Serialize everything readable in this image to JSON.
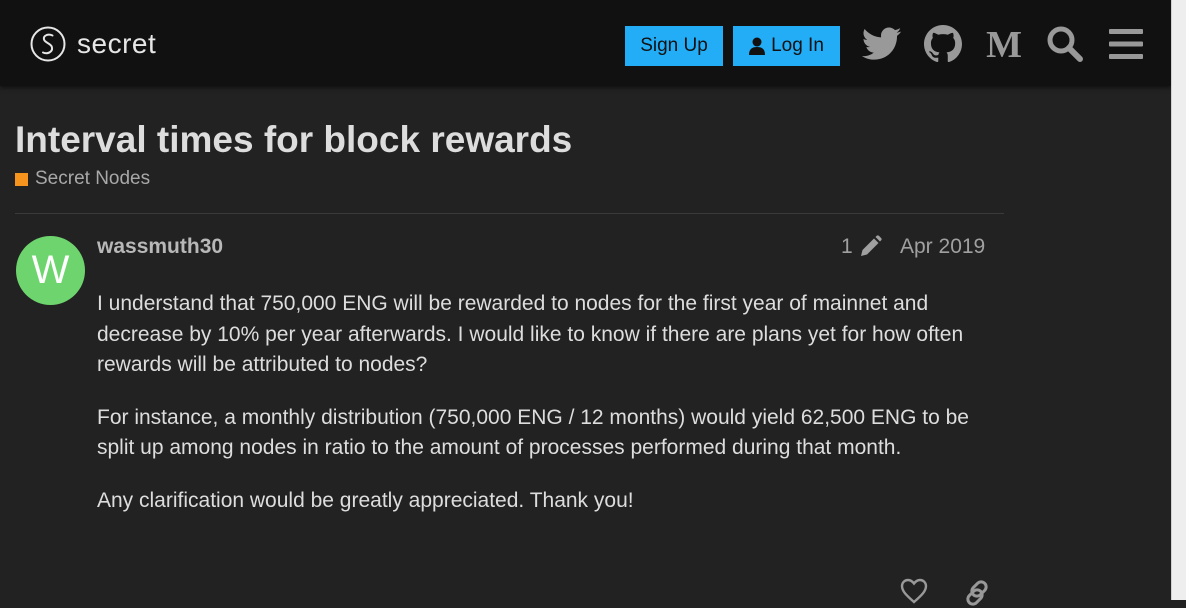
{
  "header": {
    "logo_text": "secret",
    "signup_label": "Sign Up",
    "login_label": "Log In",
    "icons": [
      "twitter-icon",
      "github-icon",
      "medium-icon",
      "search-icon",
      "hamburger-menu-icon"
    ]
  },
  "topic": {
    "title": "Interval times for block rewards",
    "category": "Secret Nodes",
    "category_color": "#f7941d"
  },
  "post": {
    "avatar_letter": "W",
    "avatar_color": "#6ed56e",
    "username": "wassmuth30",
    "edit_count": "1",
    "date": "Apr 2019",
    "paragraphs": [
      "I understand that 750,000 ENG will be rewarded to nodes for the first year of mainnet and decrease by 10% per year afterwards. I would like to know if there are plans yet for how often rewards will be attributed to nodes?",
      "For instance, a monthly distribution (750,000 ENG / 12 months) would yield 62,500 ENG to be split up among nodes in ratio to the amount of processes performed during that month.",
      "Any clarification would be greatly appreciated. Thank you!"
    ],
    "actions": [
      "heart-icon",
      "link-icon"
    ]
  },
  "colors": {
    "accent": "#22adf6",
    "background": "#222222",
    "header_background": "#111111"
  }
}
